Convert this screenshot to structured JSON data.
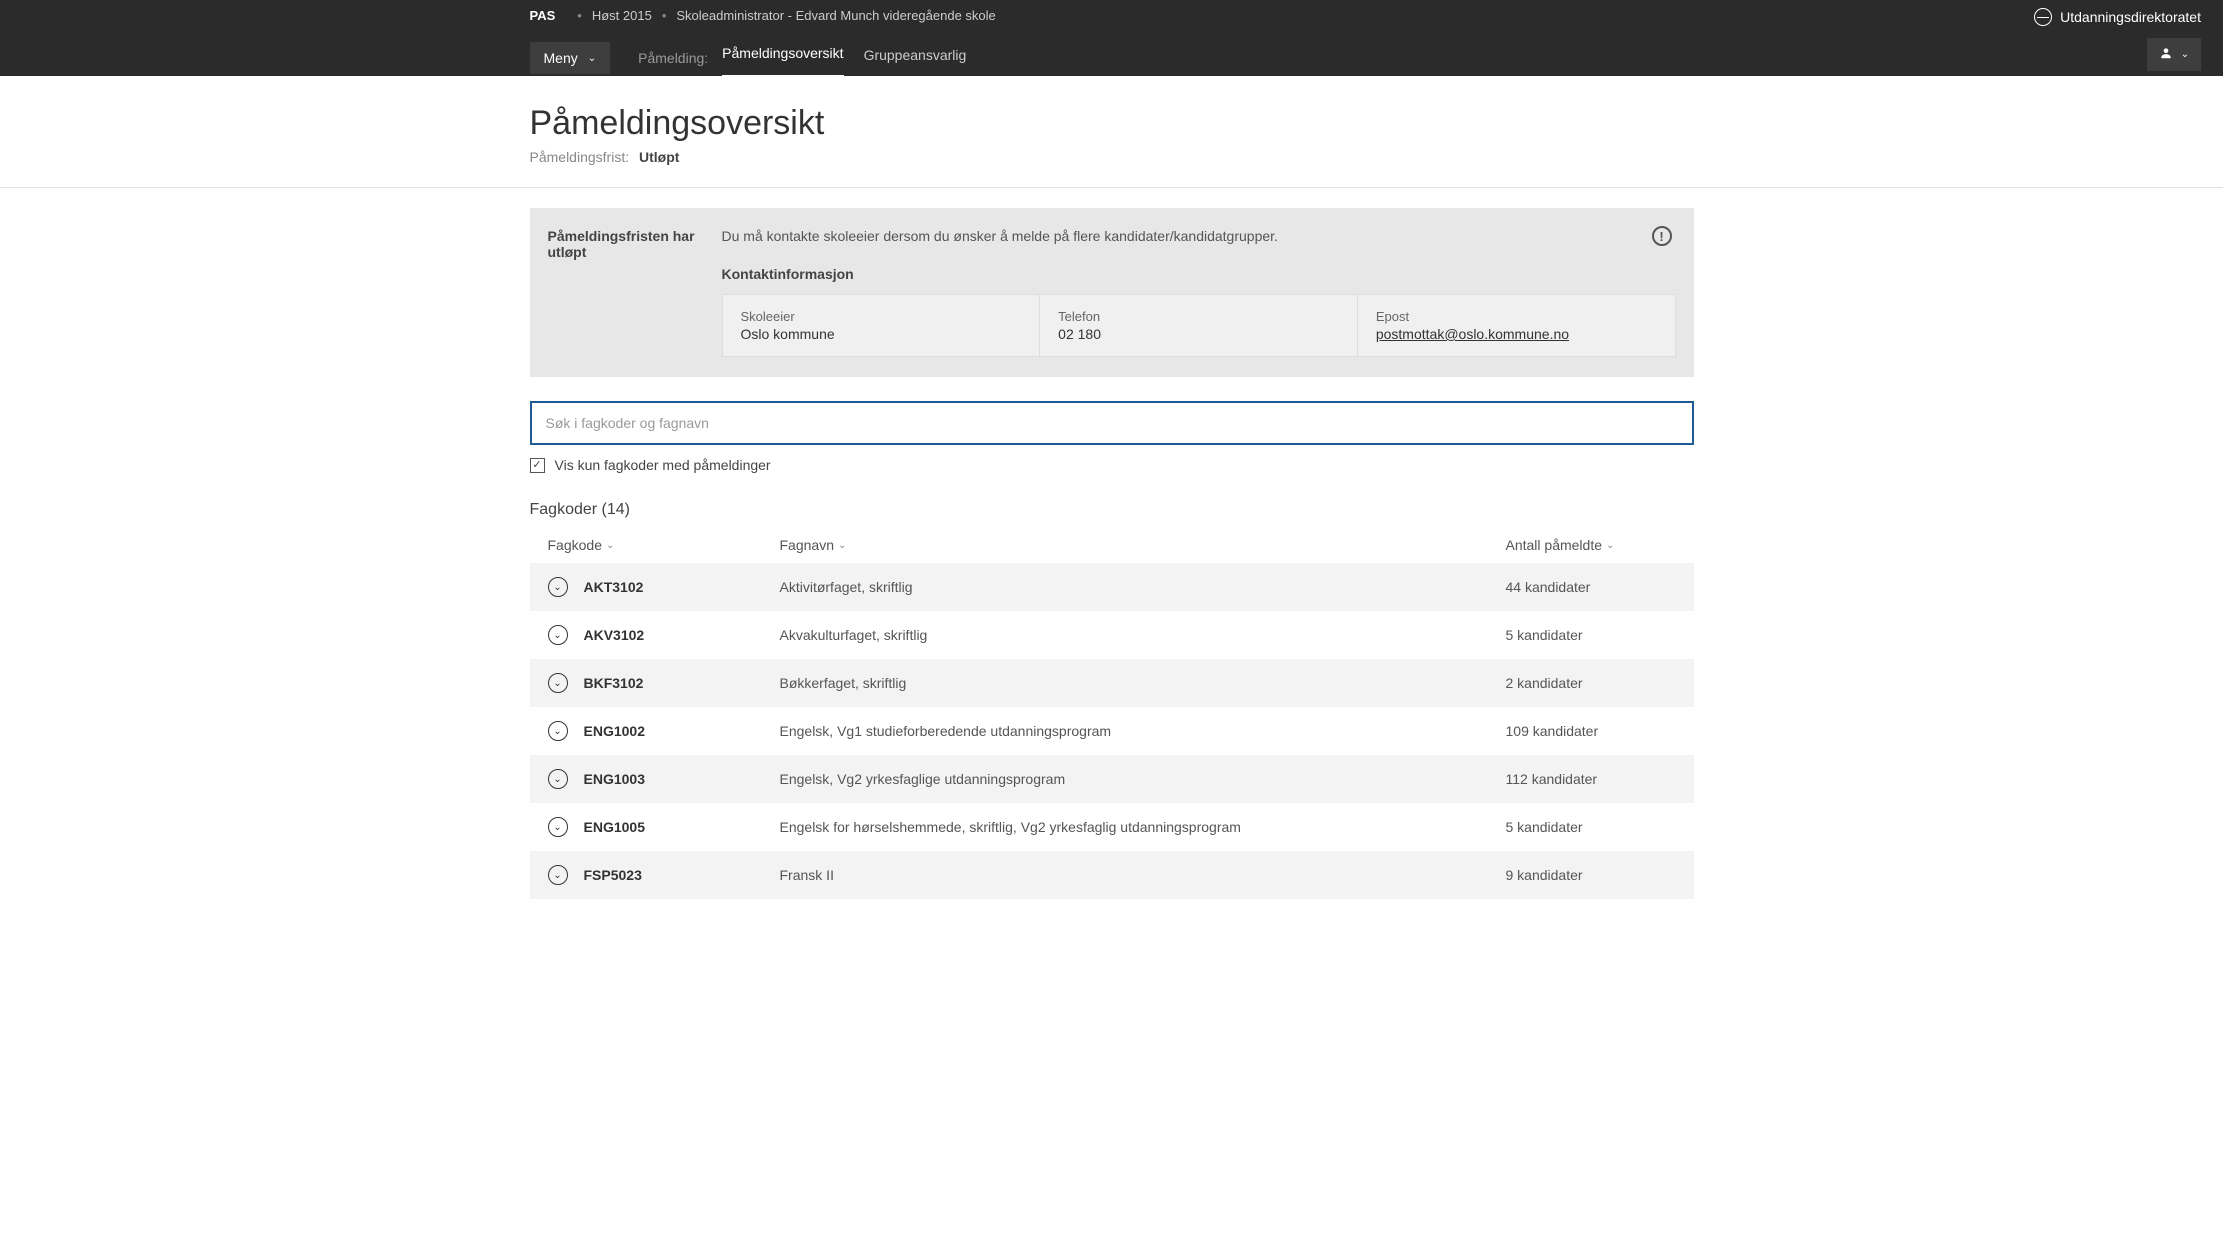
{
  "breadcrumb": {
    "app": "PAS",
    "term": "Høst 2015",
    "role": "Skoleadministrator - Edvard Munch videregående skole"
  },
  "brand": "Utdanningsdirektoratet",
  "nav": {
    "meny": "Meny",
    "label": "Påmelding:",
    "tabs": [
      {
        "label": "Påmeldingsoversikt",
        "active": true
      },
      {
        "label": "Gruppeansvarlig",
        "active": false
      }
    ]
  },
  "page": {
    "title": "Påmeldingsoversikt",
    "deadline_label": "Påmeldingsfrist:",
    "deadline_value": "Utløpt"
  },
  "notice": {
    "heading": "Påmeldingsfristen har utløpt",
    "message": "Du må kontakte skoleeier dersom du ønsker å melde på flere kandidater/kandidatgrupper.",
    "contact_title": "Kontaktinformasjon",
    "owner_label": "Skoleeier",
    "owner_value": "Oslo kommune",
    "phone_label": "Telefon",
    "phone_value": "02 180",
    "email_label": "Epost",
    "email_value": "postmottak@oslo.kommune.no",
    "icon_glyph": "!"
  },
  "search": {
    "placeholder": "Søk i fagkoder og fagnavn"
  },
  "filter": {
    "checkbox_label": "Vis kun fagkoder med påmeldinger",
    "checked_glyph": "✓"
  },
  "list": {
    "title": "Fagkoder (14)",
    "col_code": "Fagkode",
    "col_name": "Fagnavn",
    "col_count": "Antall påmeldte",
    "rows": [
      {
        "code": "AKT3102",
        "name": "Aktivitørfaget, skriftlig",
        "count": "44 kandidater"
      },
      {
        "code": "AKV3102",
        "name": "Akvakulturfaget, skriftlig",
        "count": "5 kandidater"
      },
      {
        "code": "BKF3102",
        "name": "Bøkkerfaget, skriftlig",
        "count": "2 kandidater"
      },
      {
        "code": "ENG1002",
        "name": "Engelsk, Vg1 studieforberedende utdanningsprogram",
        "count": "109 kandidater"
      },
      {
        "code": "ENG1003",
        "name": "Engelsk, Vg2 yrkesfaglige utdanningsprogram",
        "count": "112 kandidater"
      },
      {
        "code": "ENG1005",
        "name": "Engelsk for hørselshemmede, skriftlig, Vg2 yrkesfaglig utdanningsprogram",
        "count": "5 kandidater"
      },
      {
        "code": "FSP5023",
        "name": "Fransk II",
        "count": "9 kandidater"
      }
    ]
  }
}
